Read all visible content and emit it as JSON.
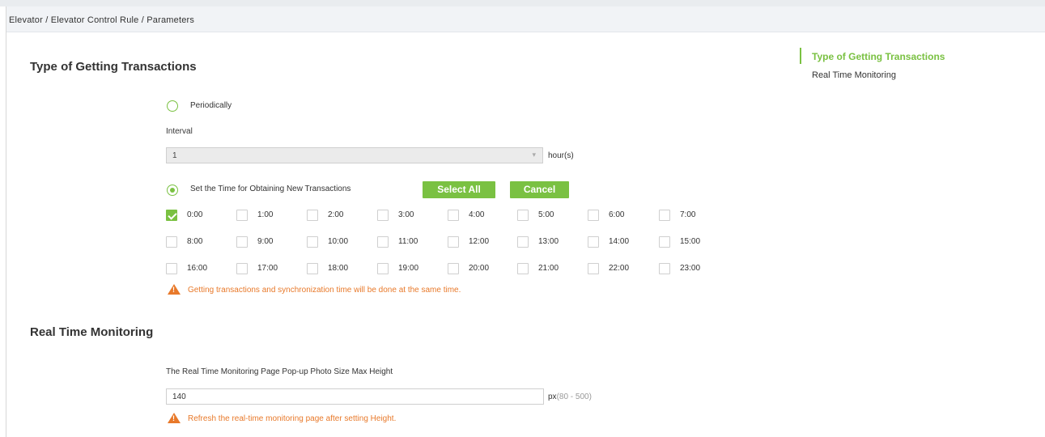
{
  "breadcrumb": "Elevator / Elevator Control Rule / Parameters",
  "transactions": {
    "title": "Type of Getting Transactions",
    "periodically_label": "Periodically",
    "interval_label": "Interval",
    "interval_value": "1",
    "interval_unit": "hour(s)",
    "set_time_label": "Set the Time for Obtaining New Transactions",
    "select_all_label": "Select All",
    "cancel_label": "Cancel",
    "hours": [
      {
        "label": "0:00",
        "checked": true
      },
      {
        "label": "1:00",
        "checked": false
      },
      {
        "label": "2:00",
        "checked": false
      },
      {
        "label": "3:00",
        "checked": false
      },
      {
        "label": "4:00",
        "checked": false
      },
      {
        "label": "5:00",
        "checked": false
      },
      {
        "label": "6:00",
        "checked": false
      },
      {
        "label": "7:00",
        "checked": false
      },
      {
        "label": "8:00",
        "checked": false
      },
      {
        "label": "9:00",
        "checked": false
      },
      {
        "label": "10:00",
        "checked": false
      },
      {
        "label": "11:00",
        "checked": false
      },
      {
        "label": "12:00",
        "checked": false
      },
      {
        "label": "13:00",
        "checked": false
      },
      {
        "label": "14:00",
        "checked": false
      },
      {
        "label": "15:00",
        "checked": false
      },
      {
        "label": "16:00",
        "checked": false
      },
      {
        "label": "17:00",
        "checked": false
      },
      {
        "label": "18:00",
        "checked": false
      },
      {
        "label": "19:00",
        "checked": false
      },
      {
        "label": "20:00",
        "checked": false
      },
      {
        "label": "21:00",
        "checked": false
      },
      {
        "label": "22:00",
        "checked": false
      },
      {
        "label": "23:00",
        "checked": false
      }
    ],
    "warning": "Getting transactions and synchronization time will be done at the same time."
  },
  "monitoring": {
    "title": "Real Time Monitoring",
    "photo_size_label": "The Real Time Monitoring Page Pop-up Photo Size  Max Height",
    "height_value": "140",
    "unit": "px",
    "range": "(80 - 500)",
    "warning": "Refresh the real-time monitoring page after setting Height."
  },
  "anchor_nav": {
    "items": [
      "Type of Getting Transactions",
      "Real Time Monitoring"
    ],
    "active_index": 0
  },
  "colors": {
    "accent": "#7ac142",
    "warning": "#e8792a"
  }
}
